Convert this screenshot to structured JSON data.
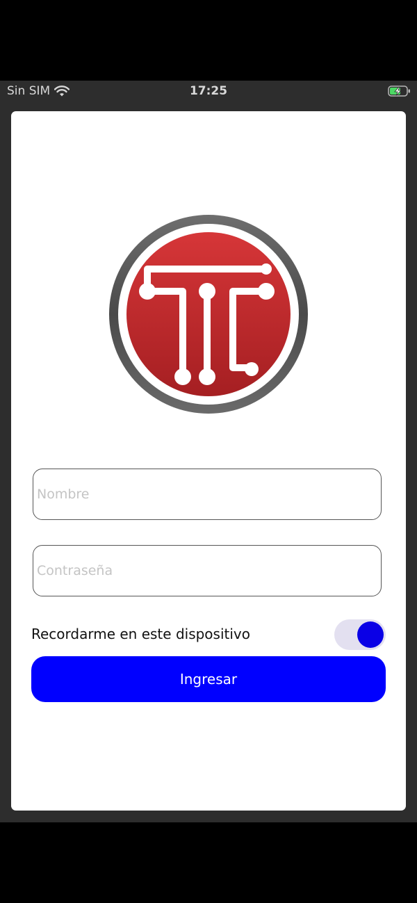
{
  "status_bar": {
    "carrier": "Sin SIM",
    "time": "17:25",
    "wifi_icon": "wifi-icon",
    "battery_icon": "battery-charging-icon"
  },
  "login": {
    "logo_icon": "tc-logo",
    "name_placeholder": "Nombre",
    "password_placeholder": "Contraseña",
    "remember_label": "Recordarme en este dispositivo",
    "remember_on": true,
    "submit_label": "Ingresar"
  },
  "colors": {
    "primary": "#0000ff",
    "toggle_track": "#e3e0f0",
    "logo_red": "#c62828"
  }
}
